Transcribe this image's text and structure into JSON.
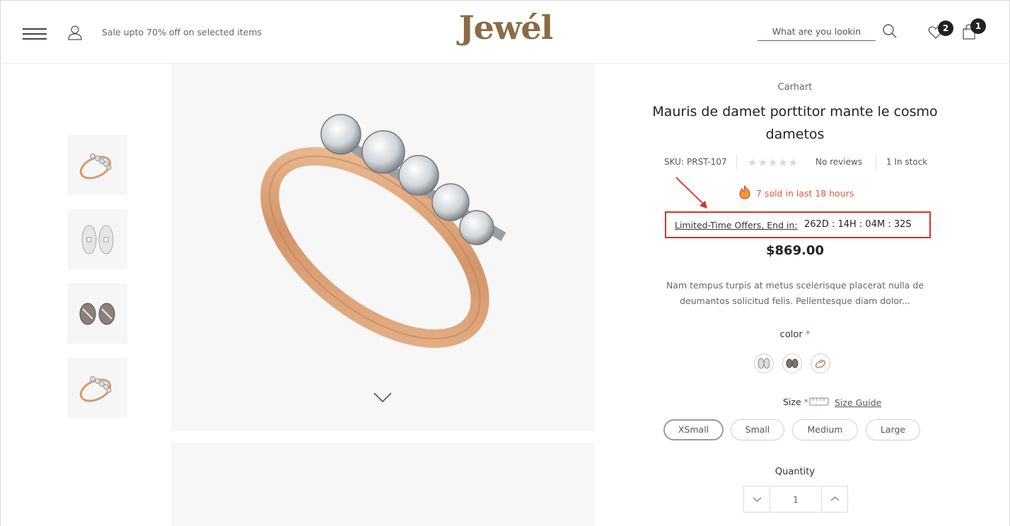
{
  "header": {
    "promo": "Sale upto 70% off on selected items",
    "logo": "Jewél",
    "search_placeholder": "What are you lookin",
    "wishlist_count": "2",
    "cart_count": "1",
    "icons": [
      "menu-icon",
      "user-icon",
      "search-icon",
      "heart-icon",
      "bag-icon"
    ]
  },
  "gallery": {
    "thumbnails": [
      "ring-thumbnail",
      "silver-earrings-thumbnail",
      "striped-earrings-thumbnail",
      "ring-thumbnail"
    ],
    "next_icon": "chevron-down-icon"
  },
  "product": {
    "vendor": "Carhart",
    "title": "Mauris de damet porttitor mante le cosmo dametos",
    "sku_label": "SKU:",
    "sku": "PRST-107",
    "stars": "★★★★★",
    "reviews": "No reviews",
    "stock": "1 In stock",
    "sold_text": "7 sold in last 18 hours",
    "offer_label": "Limited-Time Offers, End in:",
    "countdown": "262D : 14H : 04M : 32S",
    "price": "$869.00",
    "description": "Nam tempus turpis at metus scelerisque placerat nulla de deumantos solicitud felis. Pellentesque diam dolor...",
    "color_label": "color",
    "required_mark": "*",
    "size_label": "Size",
    "size_guide": "Size Guide",
    "sizes": [
      "XSmall",
      "Small",
      "Medium",
      "Large"
    ],
    "selected_size": "XSmall",
    "quantity_label": "Quantity",
    "quantity": "1"
  },
  "colors": {
    "accent": "#8a6b43",
    "alert": "#d4332f",
    "sold": "#e05a3a"
  }
}
